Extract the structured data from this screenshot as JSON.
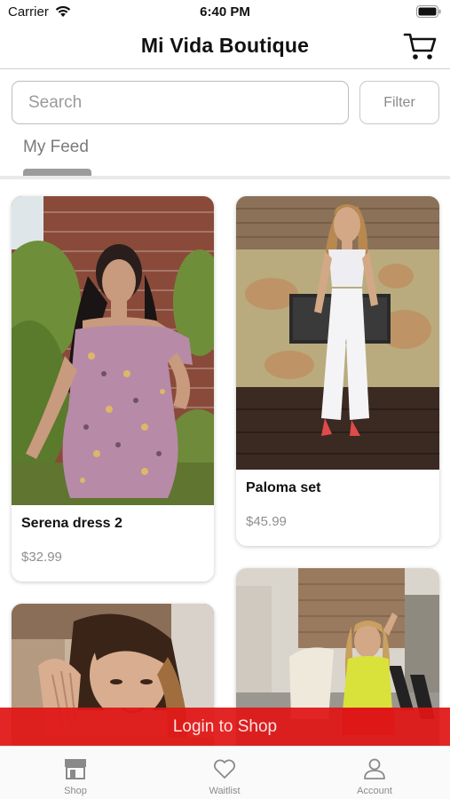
{
  "status_bar": {
    "carrier": "Carrier",
    "time": "6:40 PM"
  },
  "header": {
    "title": "Mi Vida Boutique",
    "cart_icon": "cart-icon"
  },
  "search": {
    "placeholder": "Search",
    "filter_label": "Filter"
  },
  "feed_tabs": [
    {
      "label": "My Feed",
      "selected": true
    }
  ],
  "products": [
    {
      "name": "Serena dress 2",
      "price": "$32.99"
    },
    {
      "name": "Paloma set",
      "price": "$45.99"
    },
    {
      "name": "",
      "price": ""
    },
    {
      "name": "",
      "price": ""
    }
  ],
  "login_banner": {
    "label": "Login to Shop",
    "color": "#e01616"
  },
  "tab_bar": [
    {
      "label": "Shop",
      "icon": "store-icon",
      "selected": true
    },
    {
      "label": "Waitlist",
      "icon": "heart-icon"
    },
    {
      "label": "Account",
      "icon": "person-icon"
    }
  ]
}
